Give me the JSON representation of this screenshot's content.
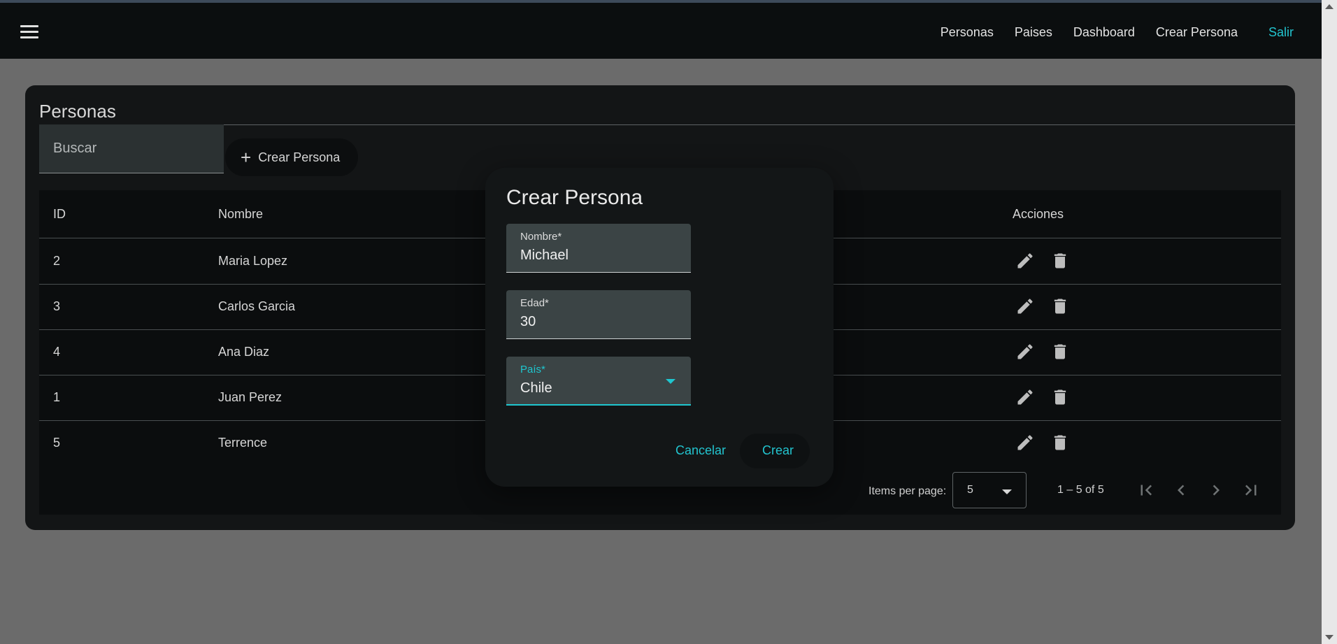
{
  "topbar": {
    "nav": [
      "Personas",
      "Paises",
      "Dashboard",
      "Crear Persona"
    ],
    "exit_label": "Salir"
  },
  "card": {
    "title": "Personas",
    "search_placeholder": "Buscar",
    "create_button": "Crear Persona"
  },
  "table": {
    "headers": {
      "id": "ID",
      "name": "Nombre",
      "actions": "Acciones"
    },
    "rows": [
      {
        "id": "2",
        "name": "Maria Lopez"
      },
      {
        "id": "3",
        "name": "Carlos Garcia"
      },
      {
        "id": "4",
        "name": "Ana Diaz"
      },
      {
        "id": "1",
        "name": "Juan Perez"
      },
      {
        "id": "5",
        "name": "Terrence"
      }
    ]
  },
  "paginator": {
    "items_per_page_label": "Items per page:",
    "items_per_page_value": "5",
    "range_label": "1 – 5 of 5"
  },
  "dialog": {
    "title": "Crear Persona",
    "fields": [
      {
        "label": "Nombre*",
        "value": "Michael"
      },
      {
        "label": "Edad*",
        "value": "30"
      },
      {
        "label": "País*",
        "value": "Chile"
      }
    ],
    "cancel_label": "Cancelar",
    "submit_label": "Crear"
  },
  "colors": {
    "accent": "#22c4cf",
    "topbar_bg": "#0b0e0f",
    "card_bg": "#131516",
    "backdrop": "#6b6b6b"
  },
  "icons": [
    "menu-icon",
    "plus-icon",
    "edit-icon",
    "delete-icon",
    "first-page-icon",
    "prev-page-icon",
    "next-page-icon",
    "last-page-icon",
    "dropdown-arrow-icon"
  ]
}
